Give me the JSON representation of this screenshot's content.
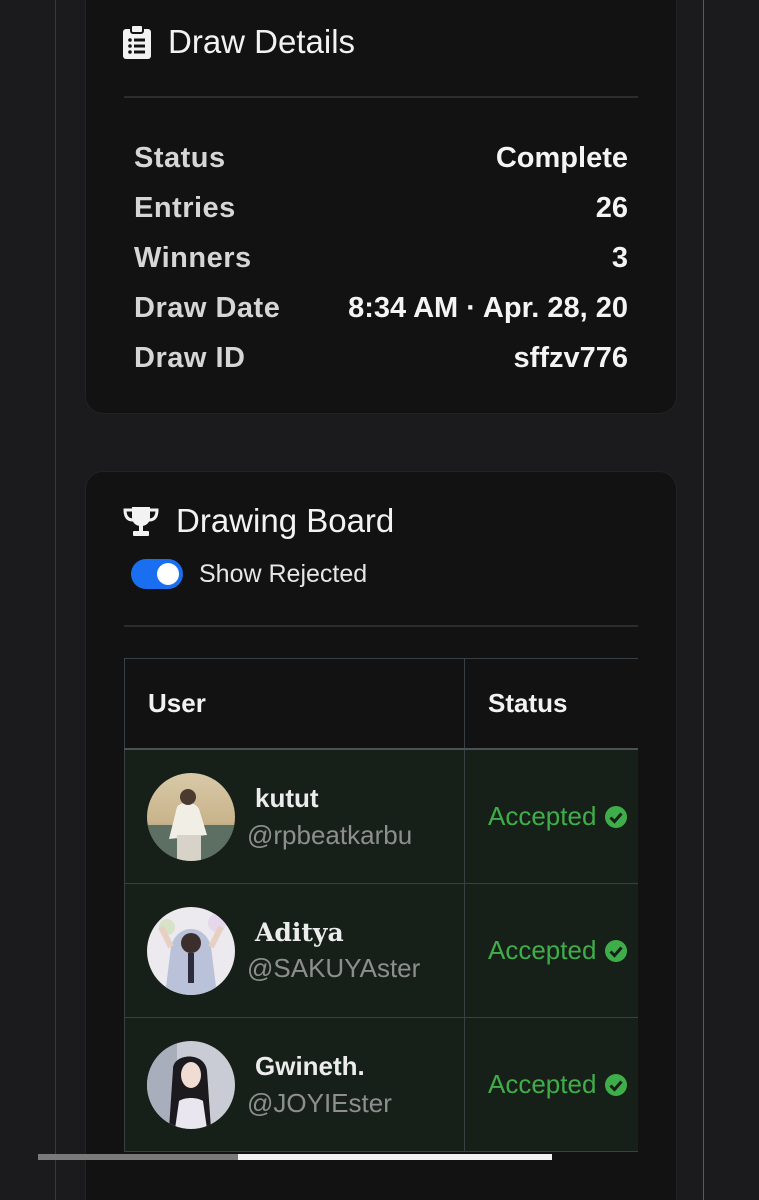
{
  "draw_details": {
    "title": "Draw Details",
    "icon": "clipboard-icon",
    "rows": [
      {
        "label": "Status",
        "value": "Complete"
      },
      {
        "label": "Entries",
        "value": "26"
      },
      {
        "label": "Winners",
        "value": "3"
      },
      {
        "label": "Draw Date",
        "value": "8:34 AM · Apr. 28, 20"
      },
      {
        "label": "Draw ID",
        "value": "sffzv776"
      }
    ]
  },
  "drawing_board": {
    "title": "Drawing Board",
    "icon": "trophy-icon",
    "toggle": {
      "label": "Show Rejected",
      "on": true
    },
    "columns": [
      "User",
      "Status"
    ],
    "entries": [
      {
        "name": "kutut",
        "handle": "@rpbeatkarbu",
        "status": "Accepted",
        "avatar": "avatar-photo"
      },
      {
        "name": "Aditya",
        "handle": "@SAKUYAster",
        "status": "Accepted",
        "avatar": "avatar-photo"
      },
      {
        "name": "Gwineth.",
        "handle": "@JOYIEster",
        "status": "Accepted",
        "avatar": "avatar-photo"
      }
    ],
    "scroll_position": 0.39
  },
  "colors": {
    "card_bg": "#121212",
    "row_bg": "#172018",
    "accepted": "#3fae4a",
    "toggle_on": "#1a6ff0"
  }
}
